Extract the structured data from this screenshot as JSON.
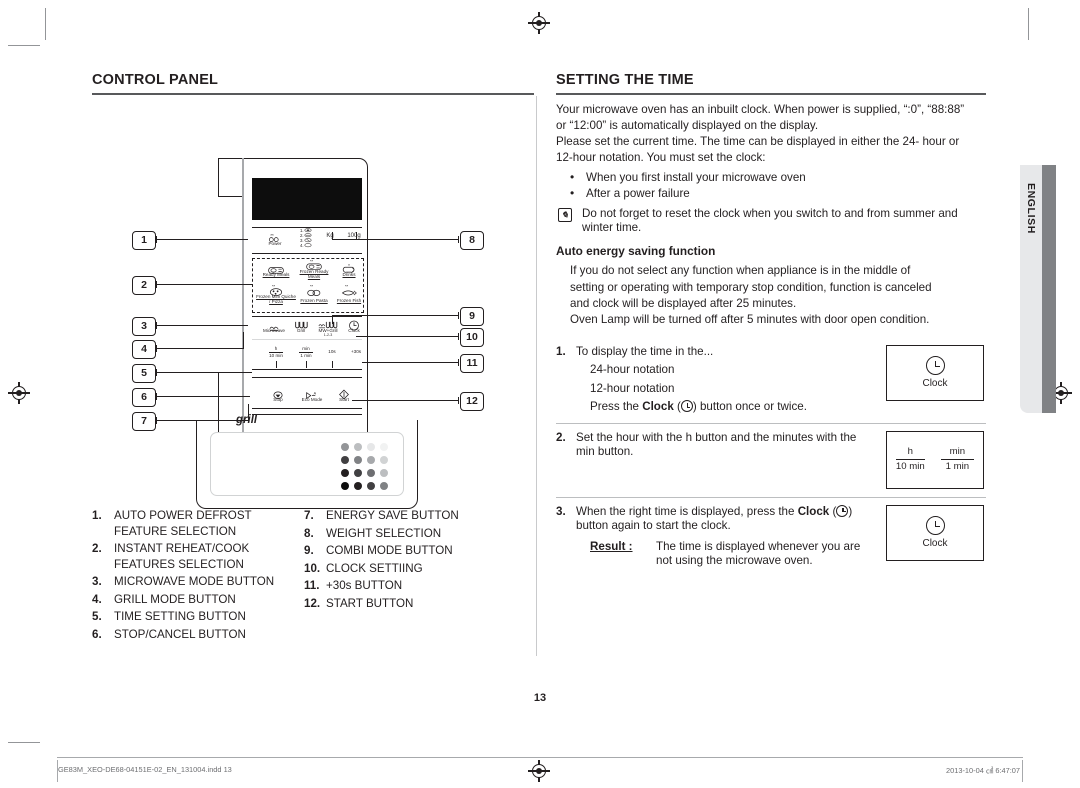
{
  "document": {
    "page_number": "13",
    "side_tab": "ENGLISH",
    "footer_left": "GE83M_XEO-DE68-04151E-02_EN_131004.indd   13",
    "footer_right": "2013-10-04   ㎠ 6:47:07"
  },
  "left": {
    "heading": "CONTROL PANEL",
    "grill_word": "grill",
    "legend_left": [
      {
        "num": "1.",
        "text": "AUTO POWER DEFROST FEATURE SELECTION"
      },
      {
        "num": "2.",
        "text": "INSTANT REHEAT/COOK FEATURES SELECTION"
      },
      {
        "num": "3.",
        "text": "MICROWAVE MODE BUTTON"
      },
      {
        "num": "4.",
        "text": "GRILL MODE BUTTON"
      },
      {
        "num": "5.",
        "text": "TIME SETTING BUTTON"
      },
      {
        "num": "6.",
        "text": "STOP/CANCEL BUTTON"
      }
    ],
    "legend_right": [
      {
        "num": "7.",
        "text": "ENERGY SAVE BUTTON"
      },
      {
        "num": "8.",
        "text": "WEIGHT SELECTION"
      },
      {
        "num": "9.",
        "text": "COMBI MODE BUTTON"
      },
      {
        "num": "10.",
        "text": "CLOCK SETTIING"
      },
      {
        "num": "11.",
        "text": "+30s BUTTON"
      },
      {
        "num": "12.",
        "text": "START BUTTON"
      }
    ],
    "callouts": [
      "1",
      "2",
      "3",
      "4",
      "5",
      "6",
      "7",
      "8",
      "9",
      "10",
      "11",
      "12"
    ],
    "panel": {
      "power_label": "Power",
      "power_list": [
        "1.",
        "2.",
        "3.",
        "4."
      ],
      "kg_label": "Kg",
      "g_label": "100g",
      "auto_buttons": [
        "Ready Meals",
        "Frozen Ready Meals",
        "Drinks",
        "Frozen Mini Quiche / Pizza",
        "Frozen Pasta",
        "Frozen Fish"
      ],
      "mode_buttons": [
        "Microwave",
        "Grill",
        "MW+Grill",
        "Clock"
      ],
      "mw_grill_sub": "1-2-3",
      "time_buttons": [
        {
          "top": "h",
          "bottom": "10 min"
        },
        {
          "top": "min",
          "bottom": "1 min"
        },
        {
          "top": "10s",
          "bottom": ""
        }
      ],
      "plus30": "+30s",
      "action_buttons": [
        "Stop",
        "Eco Mode",
        "Start"
      ]
    }
  },
  "right": {
    "heading": "SETTING THE TIME",
    "intro": [
      "Your microwave oven has an inbuilt clock. When power is supplied, “:0”, “88:88”",
      "or “12:00” is automatically displayed on the display.",
      "Please set the current time. The time can be displayed in either the 24- hour or",
      "12-hour notation. You must set the clock:"
    ],
    "bullets": [
      "When you first install your microwave oven",
      "After a power failure"
    ],
    "note": "Do not forget to reset the clock when you switch to and from summer and winter time.",
    "note_icon": "note-pencil-icon",
    "subheading": "Auto energy saving function",
    "auto_energy": [
      "If you do not select any function when appliance is in the middle of",
      "setting or operating with temporary stop condition, function is canceled",
      "and clock will be displayed after 25 minutes.",
      "Oven Lamp will be turned off after 5 minutes with door open condition."
    ],
    "steps": [
      {
        "num": "1.",
        "lines": [
          "To display the time in the..."
        ],
        "indented": [
          "24-hour notation",
          "12-hour notation"
        ],
        "press_prefix": "Press the ",
        "press_bold": "Clock",
        "press_suffix": ") button once or twice.",
        "figure": {
          "type": "clock",
          "label": "Clock"
        }
      },
      {
        "num": "2.",
        "lines": [
          "Set the hour with the h button and the minutes with the",
          "min button."
        ],
        "figure": {
          "type": "hmin",
          "items": [
            {
              "top": "h",
              "bottom": "10 min"
            },
            {
              "top": "min",
              "bottom": "1 min"
            }
          ]
        }
      },
      {
        "num": "3.",
        "lines": [
          "When the right time is displayed, press the ",
          "button again to start the clock."
        ],
        "bold_word": "Clock",
        "result_label": "Result :",
        "result_text": "The time is displayed whenever you are not using the microwave oven.",
        "figure": {
          "type": "clock",
          "label": "Clock"
        }
      }
    ]
  },
  "colors": {
    "ink": "#231f20",
    "rule": "#bcbec0",
    "tab_light": "#e7e8ea",
    "tab_dark": "#808285"
  }
}
